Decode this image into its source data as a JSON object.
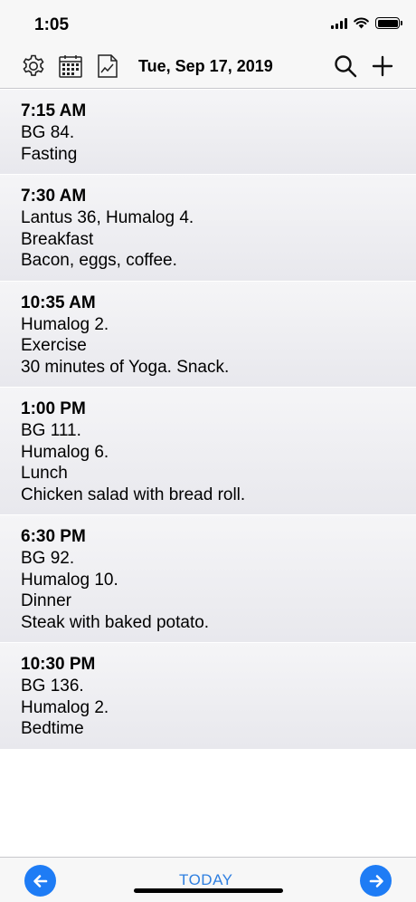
{
  "status_bar": {
    "time": "1:05"
  },
  "toolbar": {
    "date": "Tue, Sep 17, 2019",
    "icons": [
      "gear-icon",
      "calendar-icon",
      "chart-icon",
      "search-icon",
      "plus-icon"
    ]
  },
  "entries": [
    {
      "time": "7:15 AM",
      "lines": [
        "BG 84.",
        "Fasting"
      ]
    },
    {
      "time": "7:30 AM",
      "lines": [
        "Lantus 36, Humalog 4.",
        "Breakfast",
        "Bacon, eggs, coffee."
      ]
    },
    {
      "time": "10:35 AM",
      "lines": [
        "Humalog 2.",
        "Exercise",
        "30 minutes of Yoga. Snack."
      ]
    },
    {
      "time": "1:00 PM",
      "lines": [
        "BG 111.",
        "Humalog 6.",
        "Lunch",
        "Chicken salad with bread roll."
      ]
    },
    {
      "time": "6:30 PM",
      "lines": [
        "BG 92.",
        "Humalog 10.",
        "Dinner",
        "Steak with baked potato."
      ]
    },
    {
      "time": "10:30 PM",
      "lines": [
        "BG 136.",
        "Humalog 2.",
        "Bedtime"
      ]
    }
  ],
  "bottom_bar": {
    "today_label": "TODAY"
  },
  "colors": {
    "accent": "#1e7cf5",
    "row_bg": "#ededf2"
  }
}
